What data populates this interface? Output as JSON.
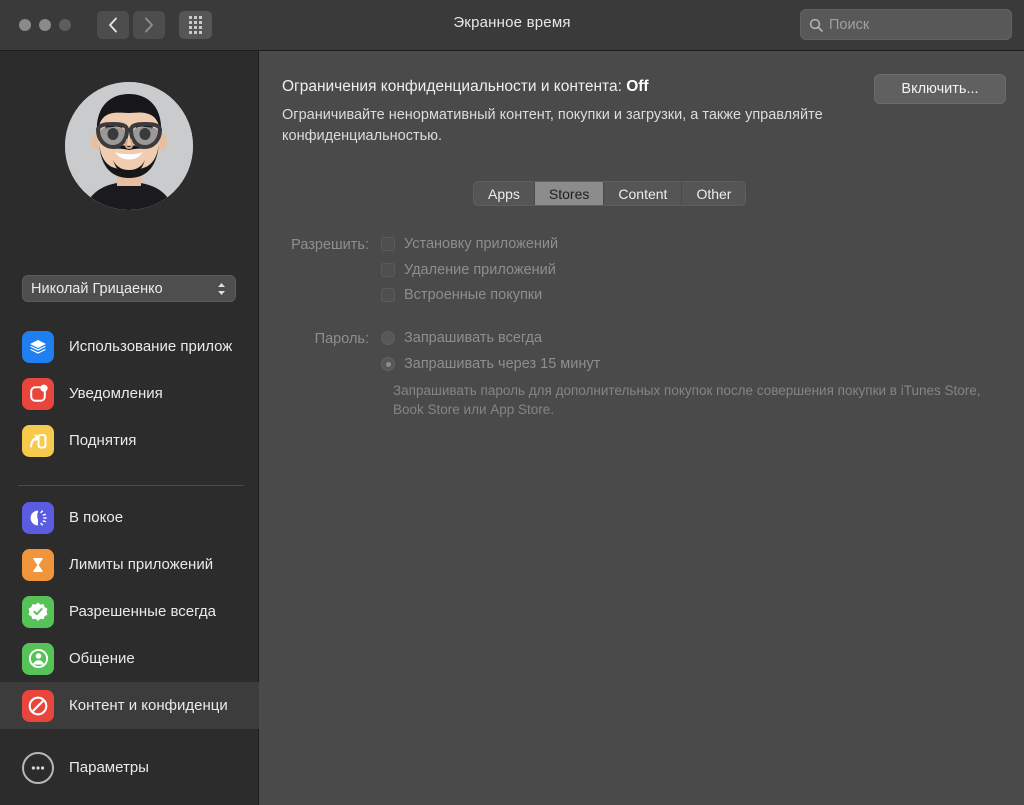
{
  "window": {
    "title": "Экранное время",
    "traffic_lights": [
      "close",
      "minimize",
      "zoom"
    ],
    "back_label": "Назад",
    "forward_label": "Вперед",
    "grid_label": "Показать все",
    "colors": {
      "titlebar": "#3a3a3a",
      "sidebar": "#2c2c2c",
      "content": "#4a4a4a",
      "selected_row": "#3c3c3c",
      "accent_segment": "#8c8c8c"
    }
  },
  "search": {
    "placeholder": "Поиск",
    "value": "",
    "icon": "search-icon"
  },
  "sidebar": {
    "avatar_name": "memoji-avatar",
    "user_popup": {
      "value": "Николай Грицаенко",
      "icon": "chevron-updown-icon"
    },
    "items": [
      {
        "label": "Использование прилож",
        "icon": "app-usage-icon",
        "color": "#1f7ff0",
        "selected": false
      },
      {
        "label": "Уведомления",
        "icon": "notifications-icon",
        "color": "#e8453c",
        "selected": false
      },
      {
        "label": "Поднятия",
        "icon": "pickups-icon",
        "color": "#f4c councillor",
        "selected": false
      }
    ],
    "items_top": [
      {
        "label": "Использование прилож",
        "icon": "app-usage-icon",
        "color": "#1f7ff0",
        "selected": false
      },
      {
        "label": "Уведомления",
        "icon": "notifications-icon",
        "color": "#e8453c",
        "selected": false
      },
      {
        "label": "Поднятия",
        "icon": "pickups-icon",
        "color": "#f6ca4c",
        "selected": false
      }
    ],
    "items_bottom": [
      {
        "label": "В покое",
        "icon": "downtime-icon",
        "color": "#5b5ce2",
        "selected": false
      },
      {
        "label": "Лимиты приложений",
        "icon": "app-limits-icon",
        "color": "#f0953b",
        "selected": false
      },
      {
        "label": "Разрешенные всегда",
        "icon": "always-allowed-icon",
        "color": "#57c257",
        "selected": false
      },
      {
        "label": "Общение",
        "icon": "communication-icon",
        "color": "#57c257",
        "selected": false
      },
      {
        "label": "Контент и конфиденци",
        "icon": "content-privacy-icon",
        "color": "#e8453c",
        "selected": true
      }
    ],
    "options": {
      "label": "Параметры",
      "icon": "ellipsis-circle-icon"
    }
  },
  "main": {
    "header": {
      "title_prefix": "Ограничения конфиденциальности и контента: ",
      "status": "Off",
      "description": "Ограничивайте ненормативный контент, покупки и загрузки, а также управляйте конфиденциальностью.",
      "enable_button": "Включить..."
    },
    "tabs": [
      {
        "label": "Apps",
        "active": false
      },
      {
        "label": "Stores",
        "active": true
      },
      {
        "label": "Content",
        "active": false
      },
      {
        "label": "Other",
        "active": false
      }
    ],
    "allow": {
      "label": "Разрешить:",
      "checkboxes": [
        {
          "label": "Установку приложений",
          "checked": false,
          "disabled": true
        },
        {
          "label": "Удаление приложений",
          "checked": false,
          "disabled": true
        },
        {
          "label": "Встроенные покупки",
          "checked": false,
          "disabled": true
        }
      ]
    },
    "password": {
      "label": "Пароль:",
      "radios": [
        {
          "label": "Запрашивать всегда",
          "selected": false,
          "disabled": true
        },
        {
          "label": "Запрашивать через 15 минут",
          "selected": true,
          "disabled": true
        }
      ],
      "note": "Запрашивать пароль для дополнительных покупок после совершения покупки в iTunes Store, Book Store или App Store."
    }
  }
}
